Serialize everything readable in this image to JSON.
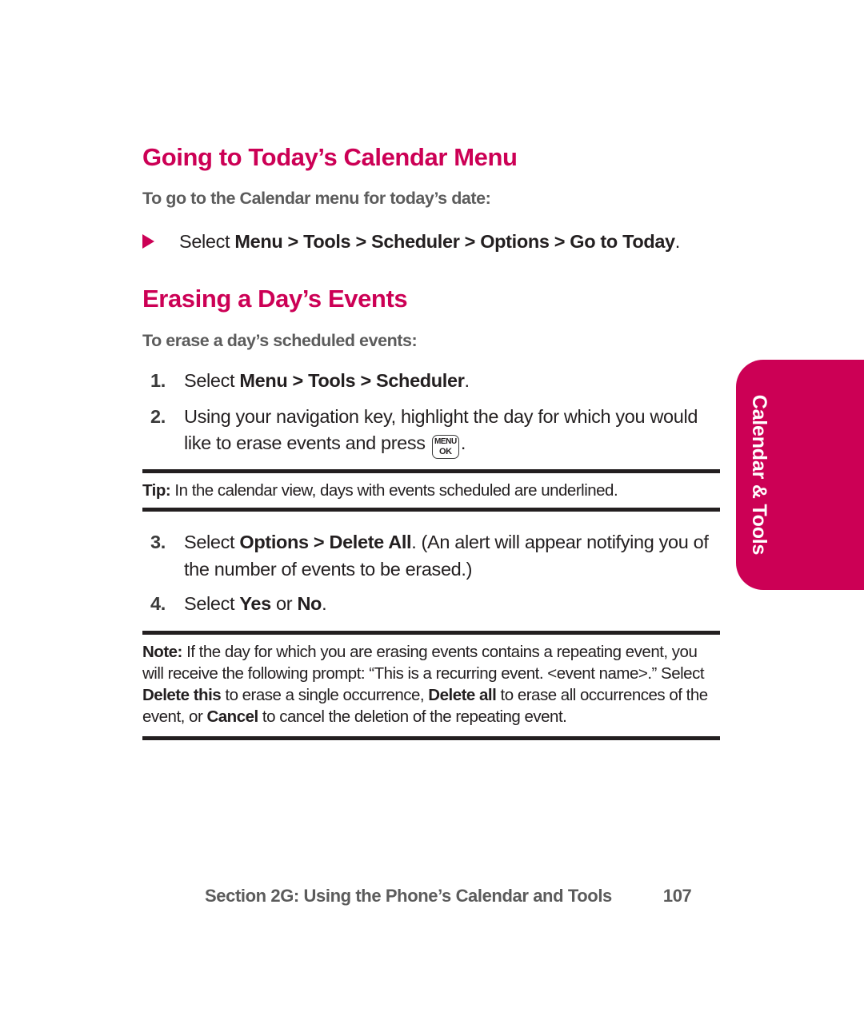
{
  "colors": {
    "accent": "#CC0055",
    "body_text": "#231F20",
    "gray_text": "#5C5C5C",
    "rule": "#231F20",
    "tab_text": "#FFFFFF"
  },
  "side_tab": {
    "label": "Calendar & Tools"
  },
  "sections": [
    {
      "title": "Going to Today’s Calendar Menu",
      "subhead": "To go to the Calendar menu for today’s date:",
      "bullet": {
        "icon": "triangle-right-icon",
        "prefix": "Select ",
        "bold1": "Menu",
        "sep1": " > ",
        "bold2": "Tools",
        "sep2": " > ",
        "bold3": "Scheduler",
        "sep3": " > ",
        "bold4": "Options",
        "sep4": " > ",
        "bold5": "Go to Today",
        "suffix": "."
      }
    },
    {
      "title": "Erasing a Day’s Events",
      "subhead": "To erase a day’s scheduled events:"
    }
  ],
  "steps": [
    {
      "num": "1.",
      "prefix": "Select ",
      "bold1": "Menu",
      "sep1": " > ",
      "bold2": "Tools",
      "sep2": " > ",
      "bold3": "Scheduler",
      "suffix": "."
    },
    {
      "num": "2.",
      "text_before_key": "Using your navigation key, highlight the day for which you would like to erase events and press ",
      "key": {
        "name": "menu-ok-key-icon",
        "line1": "MENU",
        "line2": "OK"
      },
      "text_after_key": "."
    },
    {
      "num": "3.",
      "prefix": "Select ",
      "bold1": "Options",
      "sep1": " > ",
      "bold2": "Delete All",
      "suffix": ". (An alert will appear notifying you of the number of events to be erased.)"
    },
    {
      "num": "4.",
      "prefix": "Select ",
      "bold1": "Yes",
      "sep1": " or ",
      "bold2": "No",
      "suffix": "."
    }
  ],
  "tip": {
    "label": "Tip:",
    "text": " In the calendar view, days with events scheduled are underlined."
  },
  "note": {
    "label": "Note:",
    "part1": " If the day for which you are erasing events contains a repeating event, you will receive the following prompt: “This is a recurring event. <event name>.” Select ",
    "bold1": "Delete this",
    "part2": " to erase a single occurrence, ",
    "bold2": "Delete all",
    "part3": " to erase all occurrences of the event, or ",
    "bold3": "Cancel",
    "part4": " to cancel the deletion of the repeating event."
  },
  "footer": {
    "title": "Section 2G: Using the Phone’s Calendar and Tools",
    "page": "107"
  }
}
